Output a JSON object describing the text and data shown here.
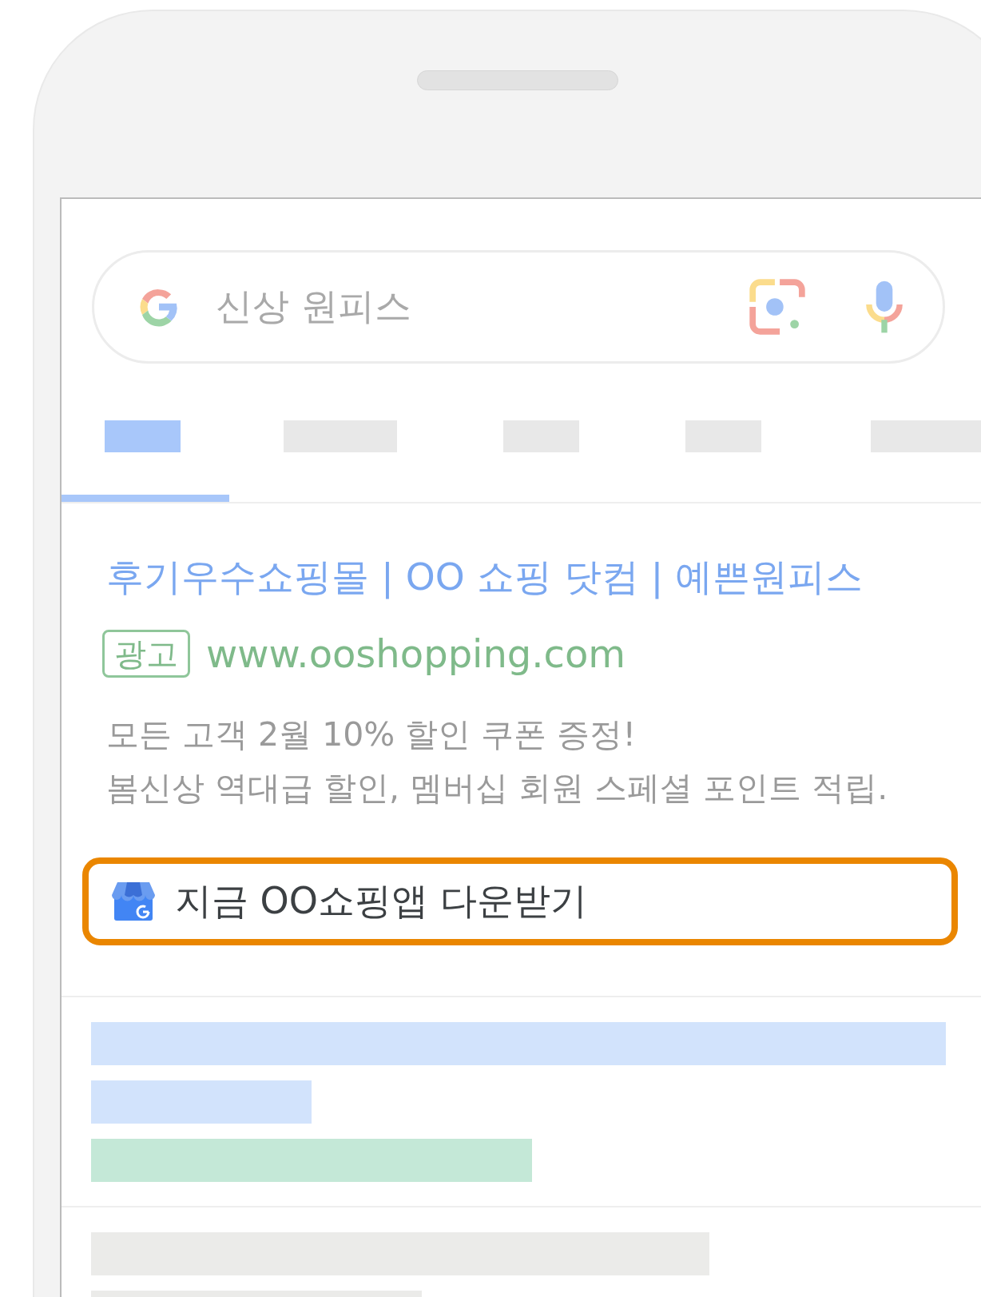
{
  "search": {
    "query": "신상 원피스"
  },
  "tabs": [
    {
      "selected": true
    },
    {
      "selected": false
    },
    {
      "selected": false
    },
    {
      "selected": false
    },
    {
      "selected": false
    }
  ],
  "ad": {
    "title": "후기우수쇼핑몰 | OO 쇼핑 닷컴 | 예쁜원피스",
    "badge": "광고",
    "url": "www.ooshopping.com",
    "description_lines": [
      "모든 고객 2월 10% 할인 쿠폰 증정!",
      "봄신상 역대급 할인, 멤버십 회원 스페셜 포인트 적립."
    ],
    "action": {
      "label": "지금 OO쇼핑앱 다운받기",
      "highlighted": true
    }
  },
  "placeholder_groups": [
    [
      {
        "color": "#d2e3fc"
      },
      {
        "color": "#d2e3fc"
      },
      {
        "color": "#c4e8d7"
      }
    ],
    [
      {
        "color": "#ebebe9"
      },
      {
        "color": "#ebebe9"
      }
    ]
  ]
}
